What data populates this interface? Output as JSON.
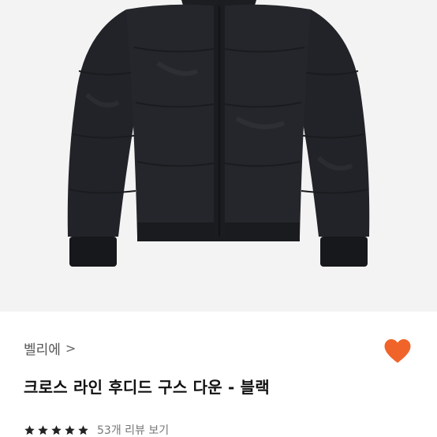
{
  "product": {
    "image_alt": "black puffer down jacket"
  },
  "brand": {
    "name": "벨리에",
    "chevron": ">"
  },
  "wishlist": {
    "icon": "heart-icon",
    "color": "#f0642a"
  },
  "title": "크로스 라인 후디드 구스 다운 - 블랙",
  "rating": {
    "stars": 5,
    "max_stars": 5,
    "star_color": "#222222",
    "review_text": "53개 리뷰 보기"
  }
}
